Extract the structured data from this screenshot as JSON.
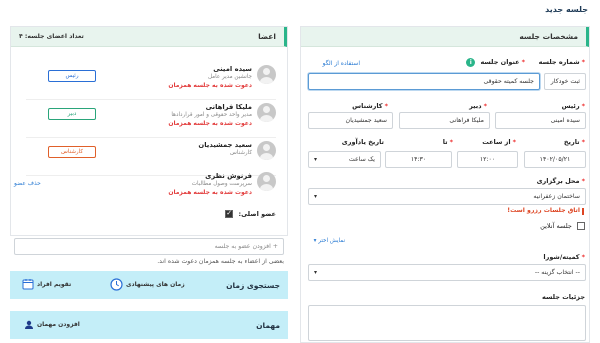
{
  "page_title": "جلسه جدید",
  "details": {
    "header": "مشخصات جلسه",
    "meeting_no_label": "شماره جلسه",
    "meeting_no_value": "ثبت خودکار",
    "title_label": "عنوان جلسه",
    "title_value": "جلسه کمیته حقوقی",
    "template_link": "استفاده از الگو",
    "chair_label": "رئیس",
    "chair_value": "سیده امینی",
    "secretary_label": "دبیر",
    "secretary_value": "ملیکا فراهانی",
    "expert_label": "کارشناس",
    "expert_value": "سعید جمشیدیان",
    "date_label": "تاریخ",
    "date_value": "۱۴۰۲/۰۵/۲۱",
    "from_label": "از ساعت",
    "from_value": "۱۲:۰۰",
    "to_label": "تا",
    "to_value": "۱۴:۳۰",
    "reminder_label": "تاریخ یادآوری",
    "reminder_value": "یک ساعت",
    "venue_label": "محل برگزاری",
    "venue_value": "ساختمان زعفرانیه",
    "venue_error": "اتاق جلسات رزرو است!",
    "online_label": "جلسه آنلاین",
    "more_link": "نمایش اختر",
    "committee_label": "کمیته/شورا",
    "committee_value": "-- انتخاب گزینه --",
    "notes_label": "جزئیات جلسه"
  },
  "members": {
    "header": "اعضا",
    "count_label": "تعداد اعضای جلسه: ۴",
    "list": [
      {
        "name": "سیده امینی",
        "role": "جانشین مدیر عامل",
        "invite": "دعوت شده به جلسه همزمان",
        "badge": "رئیس",
        "badge_color": "#2a6fd6"
      },
      {
        "name": "ملیکا فراهانی",
        "role": "مدیر واحد حقوقی و امور قراردادها",
        "invite": "دعوت شده به جلسه همزمان",
        "badge": "دبیر",
        "badge_color": "#2aa57a"
      },
      {
        "name": "سعید جمشیدیان",
        "role": "کارشناس",
        "invite": "",
        "badge": "کارشناس",
        "badge_color": "#e0602a"
      },
      {
        "name": "فرنوش نظری",
        "role": "سرپرست وصول مطالبات",
        "invite": "دعوت شده به جلسه همزمان",
        "badge": "",
        "badge_color": ""
      }
    ],
    "delete_link": "حذف عضو",
    "main_member_label": "عضو اصلی:",
    "add_member_placeholder": "+ افزودن عضو به جلسه",
    "warning_text": "بعضی از اعضاء به جلسه همزمان دعوت شده اند."
  },
  "time_search": {
    "title": "جستجوی زمان",
    "suggested": "زمان های پیشنهادی",
    "calendar": "تقویم افراد"
  },
  "guests": {
    "title": "مهمان",
    "add": "افزودن مهمان"
  },
  "colors": {
    "accent": "#2ab58a",
    "header_bg": "#e8f4ee",
    "section_bg": "#c4eef8",
    "error": "#e23a3a",
    "link": "#2a7bd3"
  }
}
